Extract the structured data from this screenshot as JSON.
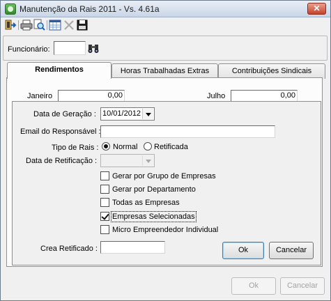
{
  "window": {
    "title": "Manutenção da Rais 2011 - Vs. 4.61a",
    "close_label": "✕"
  },
  "toolbar": {
    "icons": [
      "exit-icon",
      "print-icon",
      "preview-icon",
      "grid-icon",
      "delete-icon",
      "save-icon"
    ]
  },
  "funcionario": {
    "label": "Funcionário:",
    "value": ""
  },
  "tabs": [
    {
      "label": "Rendimentos",
      "active": true
    },
    {
      "label": "Horas Trabalhadas Extras",
      "active": false
    },
    {
      "label": "Contribuições Sindicais",
      "active": false
    }
  ],
  "partial_fields": {
    "left_label": "Janeiro",
    "left_value": "0,00",
    "right_label": "Julho",
    "right_value": "0,00"
  },
  "dialog": {
    "data_geracao_label": "Data de Geração :",
    "data_geracao_value": "10/01/2012",
    "email_label": "Email do Responsável :",
    "email_value": "",
    "tipo_rais_label": "Tipo de Rais :",
    "tipo_normal": "Normal",
    "tipo_retificada": "Retificada",
    "tipo_selected": "Normal",
    "data_retificacao_label": "Data de Retificação :",
    "data_retificacao_value": "",
    "checkboxes": [
      {
        "label": "Gerar por Grupo de Empresas",
        "checked": false
      },
      {
        "label": "Gerar por Departamento",
        "checked": false
      },
      {
        "label": "Todas as Empresas",
        "checked": false
      },
      {
        "label": "Empresas Selecionadas",
        "checked": true
      },
      {
        "label": "Micro Empreendedor Individual",
        "checked": false
      }
    ],
    "crea_label": "Crea Retificado :",
    "crea_value": "",
    "ok_label": "Ok",
    "cancel_label": "Cancelar"
  },
  "footer": {
    "ok_label": "Ok",
    "cancel_label": "Cancelar",
    "enabled": false
  }
}
